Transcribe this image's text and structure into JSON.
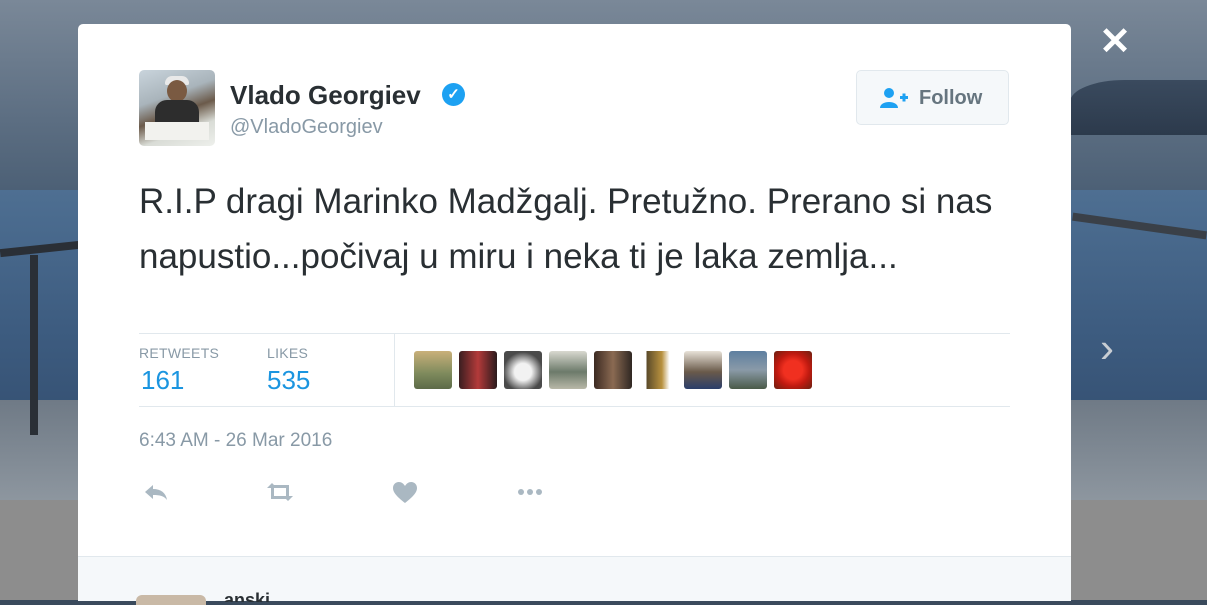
{
  "close_label": "✕",
  "next_label": "›",
  "tweet": {
    "name": "Vlado Georgiev",
    "verified_icon": "verified-badge-icon",
    "handle": "@VladoGeorgiev",
    "follow_label": "Follow",
    "text": "R.I.P dragi Marinko Madžgalj. Pretužno. Prerano si nas napustio...počivaj u miru i neka ti je laka zemlja...",
    "stats": {
      "retweets_label": "RETWEETS",
      "retweets_value": "161",
      "likes_label": "LIKES",
      "likes_value": "535"
    },
    "timestamp": "6:43 AM - 26 Mar 2016",
    "actions": [
      "reply-icon",
      "retweet-icon",
      "heart-icon",
      "more-icon"
    ]
  },
  "reply": {
    "name_partial": "anski"
  },
  "colors": {
    "accent": "#1b95e0",
    "verified": "#1da1f2",
    "text": "#292f33",
    "muted": "#8899a6",
    "border": "#e1e8ed"
  }
}
